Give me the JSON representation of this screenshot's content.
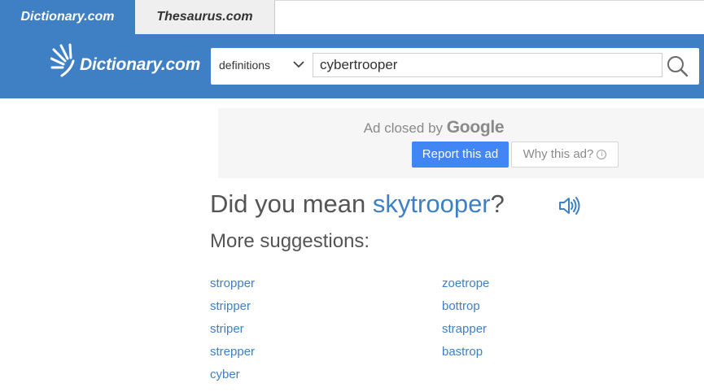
{
  "tabs": [
    {
      "label": "Dictionary.com",
      "active": true
    },
    {
      "label": "Thesaurus.com",
      "active": false
    }
  ],
  "header": {
    "logo_text": "Dictionary.com",
    "search": {
      "selector_label": "definitions",
      "query": "cybertrooper"
    }
  },
  "ad": {
    "closed_text": "Ad closed by",
    "brand": "Google",
    "report_label": "Report this ad",
    "why_label": "Why this ad?"
  },
  "main": {
    "did_you_mean_prefix": "Did you mean",
    "did_you_mean_word": "skytrooper",
    "did_you_mean_suffix": "?",
    "more_suggestions": "More suggestions:",
    "suggestions_left": [
      "stropper",
      "stripper",
      "striper",
      "strepper",
      "cyber"
    ],
    "suggestions_right": [
      "zoetrope",
      "bottrop",
      "strapper",
      "bastrop"
    ]
  },
  "colors": {
    "brand_blue": "#3f7fc4",
    "ad_button_blue": "#4285f4",
    "text_gray": "#555555"
  },
  "icons": [
    "sun-rays-logo-icon",
    "chevron-down-icon",
    "search-icon",
    "speaker-icon",
    "info-icon"
  ]
}
